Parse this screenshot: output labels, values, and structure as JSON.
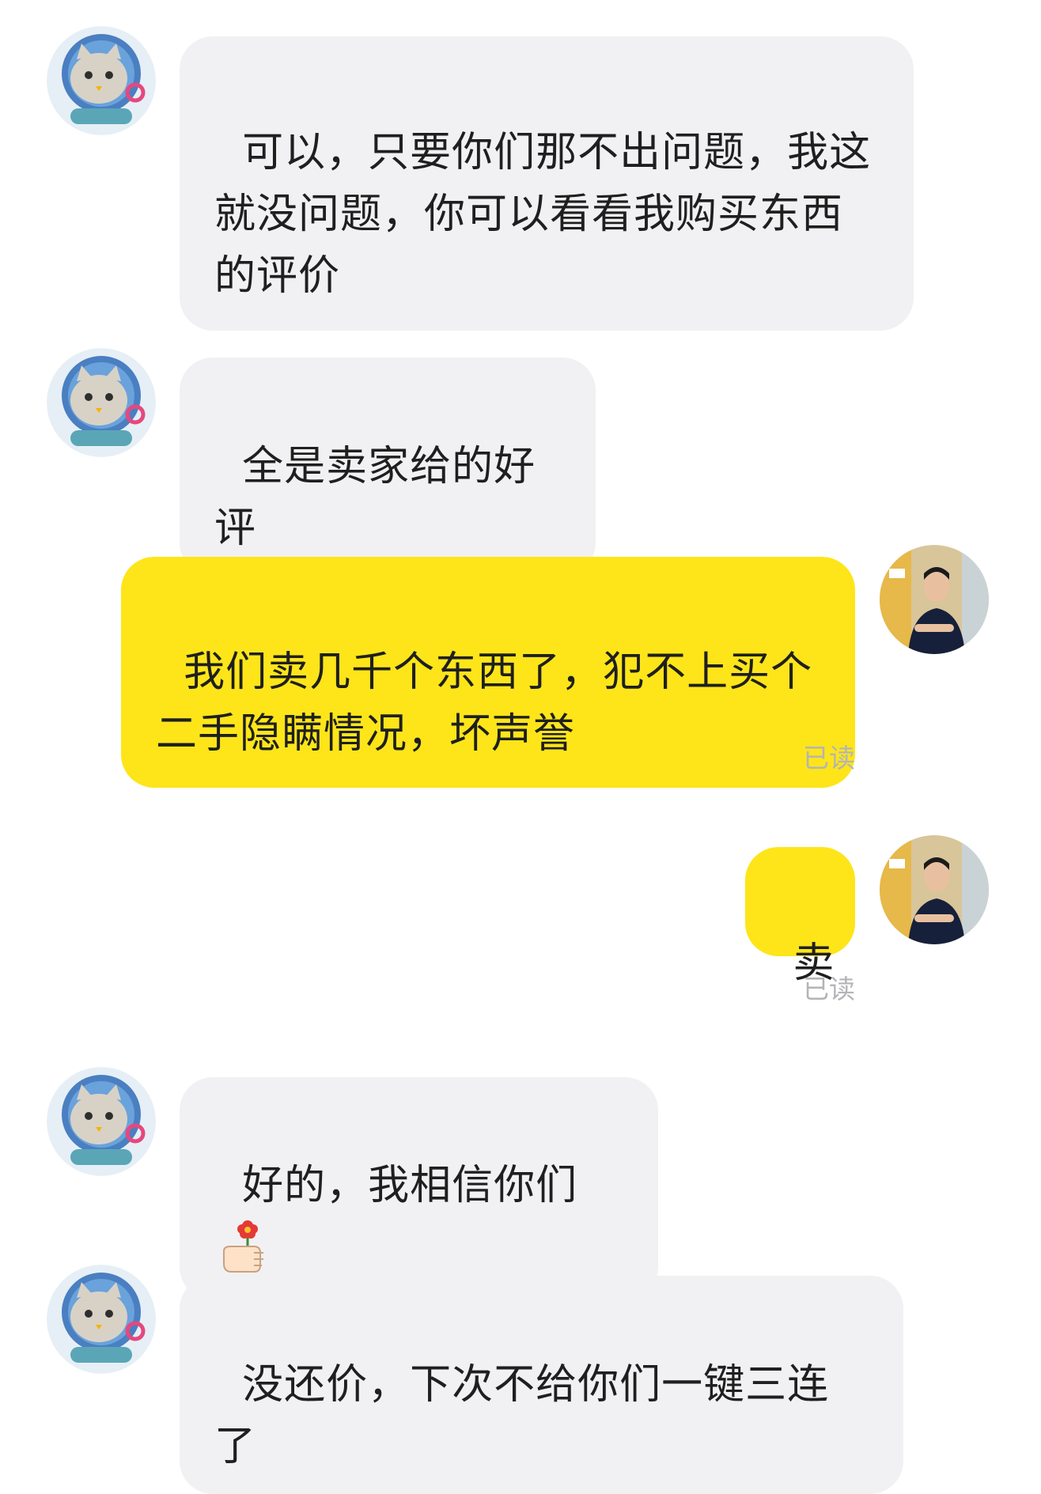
{
  "messages": [
    {
      "side": "in",
      "text": "可以，只要你们那不出问题，我这\n就没问题，你可以看看我购买东西\n的评价"
    },
    {
      "side": "in",
      "text": "全是卖家给的好评"
    },
    {
      "side": "out",
      "text": "我们卖几千个东西了，犯不上买个\n二手隐瞒情况，坏声誉",
      "status": "已读"
    },
    {
      "side": "out",
      "text": "卖",
      "status": "已读"
    },
    {
      "side": "in",
      "text": "好的，我相信你们",
      "emoji": "hand-holding-flower-icon"
    },
    {
      "side": "in",
      "text": "没还价，下次不给你们一键三连了"
    }
  ],
  "avatars": {
    "other": "cat-astronaut-avatar",
    "self": "man-photo-avatar"
  },
  "colors": {
    "incoming_bubble": "#f1f1f3",
    "outgoing_bubble": "#fde51a",
    "text": "#1f1f1f",
    "read_receipt": "#b4b4b8"
  }
}
